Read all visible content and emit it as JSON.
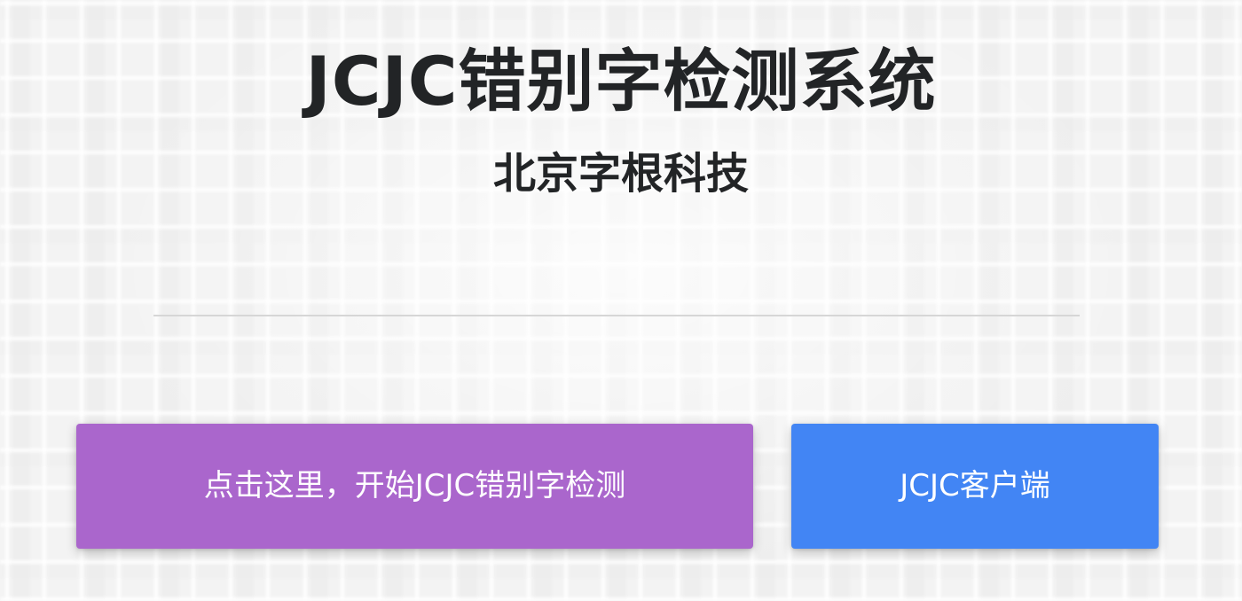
{
  "header": {
    "title": "JCJC错别字检测系统",
    "subtitle": "北京字根科技"
  },
  "actions": {
    "start_detection_label": "点击这里，开始JCJC错别字检测",
    "client_label": "JCJC客户端"
  },
  "colors": {
    "start_detection_button": "#aa66cc",
    "client_button": "#4285f4",
    "title_text": "#222426",
    "divider": "#d6d6d6"
  }
}
